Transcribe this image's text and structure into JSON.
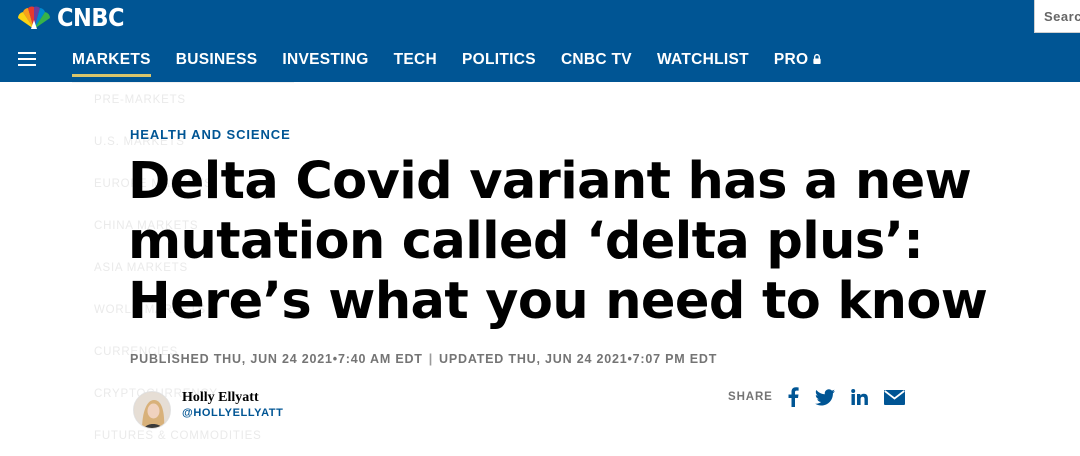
{
  "brand": {
    "logo_text": "CNBC",
    "nav_bg": "#005594",
    "accent_underline": "#d9c56b",
    "link_color": "#005594"
  },
  "search": {
    "placeholder": "Search"
  },
  "nav": {
    "menu_icon": "hamburger-menu-icon",
    "items": [
      {
        "label": "MARKETS",
        "active": true
      },
      {
        "label": "BUSINESS"
      },
      {
        "label": "INVESTING"
      },
      {
        "label": "TECH"
      },
      {
        "label": "POLITICS"
      },
      {
        "label": "CNBC TV"
      },
      {
        "label": "WATCHLIST"
      },
      {
        "label": "PRO",
        "icon": "lock-icon"
      }
    ]
  },
  "markets_submenu": [
    "PRE-MARKETS",
    "U.S. MARKETS",
    "EUROPE MARKETS",
    "CHINA MARKETS",
    "ASIA MARKETS",
    "WORLD MARKETS",
    "CURRENCIES",
    "CRYPTOCURRENCY",
    "FUTURES & COMMODITIES"
  ],
  "article": {
    "section": "HEALTH AND SCIENCE",
    "headline": "Delta Covid variant has a new mutation called ‘delta plus’: Here’s what you need to know",
    "published": "PUBLISHED THU, JUN 24 2021•7:40 AM EDT",
    "separator": "|",
    "updated": "UPDATED THU, JUN 24 2021•7:07 PM EDT",
    "author": {
      "name": "Holly Ellyatt",
      "handle": "@HOLLYELLYATT"
    }
  },
  "share": {
    "label": "SHARE",
    "buttons": [
      "facebook-icon",
      "twitter-icon",
      "linkedin-icon",
      "email-icon"
    ]
  }
}
